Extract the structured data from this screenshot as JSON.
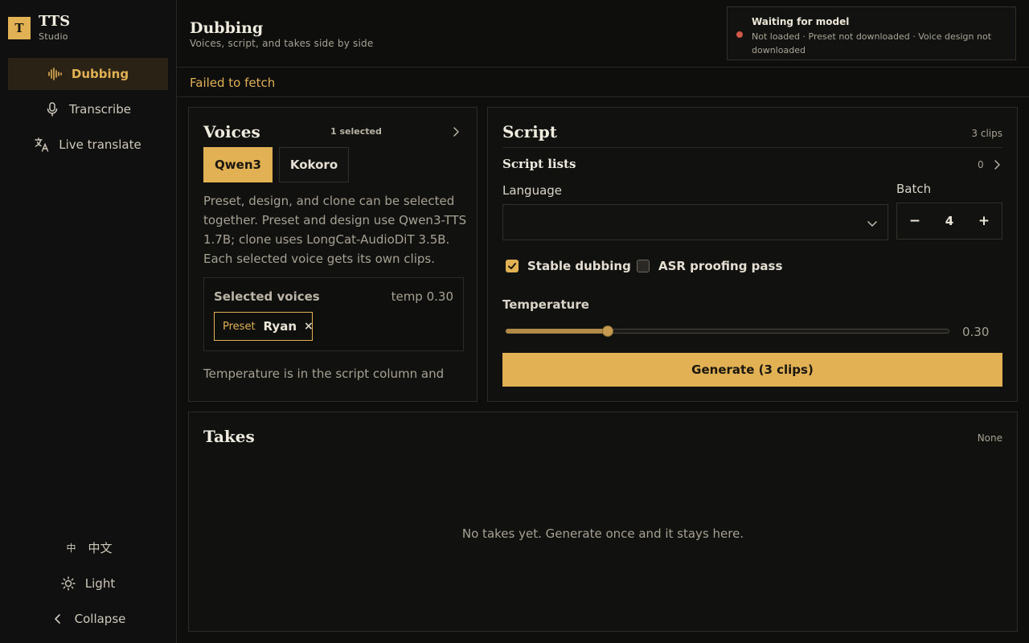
{
  "brand": {
    "logo": "T",
    "title": "TTS",
    "subtitle": "Studio"
  },
  "sidebar": {
    "nav": [
      {
        "label": "Dubbing",
        "icon": "waveform-icon",
        "active": true
      },
      {
        "label": "Transcribe",
        "icon": "microphone-icon",
        "active": false
      },
      {
        "label": "Live translate",
        "icon": "translate-icon",
        "active": false
      }
    ],
    "bottom": [
      {
        "label": "中文",
        "glyph": "中",
        "icon": "language-icon"
      },
      {
        "label": "Light",
        "icon": "sun-icon"
      },
      {
        "label": "Collapse",
        "icon": "chevron-left-icon"
      }
    ]
  },
  "header": {
    "title": "Dubbing",
    "subtitle": "Voices, script, and takes side by side",
    "status": {
      "title": "Waiting for model",
      "detail": "Not loaded · Preset not downloaded · Voice design not downloaded",
      "color": "#d0574a"
    }
  },
  "error": {
    "message": "Failed to fetch"
  },
  "voices": {
    "title": "Voices",
    "count": "1 selected",
    "tabs": [
      {
        "label": "Qwen3",
        "active": true
      },
      {
        "label": "Kokoro",
        "active": false
      }
    ],
    "description": "Preset, design, and clone can be selected together. Preset and design use Qwen3-TTS 1.7B; clone uses LongCat-AudioDiT 3.5B. Each selected voice gets its own clips.",
    "selected": {
      "label": "Selected voices",
      "temp": "temp 0.30",
      "chips": [
        {
          "tag": "Preset",
          "name": "Ryan",
          "remove": "×"
        }
      ]
    },
    "note": "Temperature is in the script column and"
  },
  "script": {
    "title": "Script",
    "clips": "3 clips",
    "lists_label": "Script lists",
    "lists_count": "0",
    "language_label": "Language",
    "language_value": "",
    "batch_label": "Batch",
    "batch_value": "4",
    "batch_minus": "−",
    "batch_plus": "+",
    "checks": [
      {
        "label": "Stable dubbing",
        "checked": true
      },
      {
        "label": "ASR proofing pass",
        "checked": false
      }
    ],
    "temperature_label": "Temperature",
    "temperature_value": "0.30",
    "temperature_fraction": 0.23,
    "generate_label": "Generate (3 clips)"
  },
  "takes": {
    "title": "Takes",
    "status": "None",
    "empty": "No takes yet. Generate once and it stays here."
  },
  "colors": {
    "accent": "#e1b154",
    "background": "#0e0e0d",
    "error": "#d0574a"
  }
}
